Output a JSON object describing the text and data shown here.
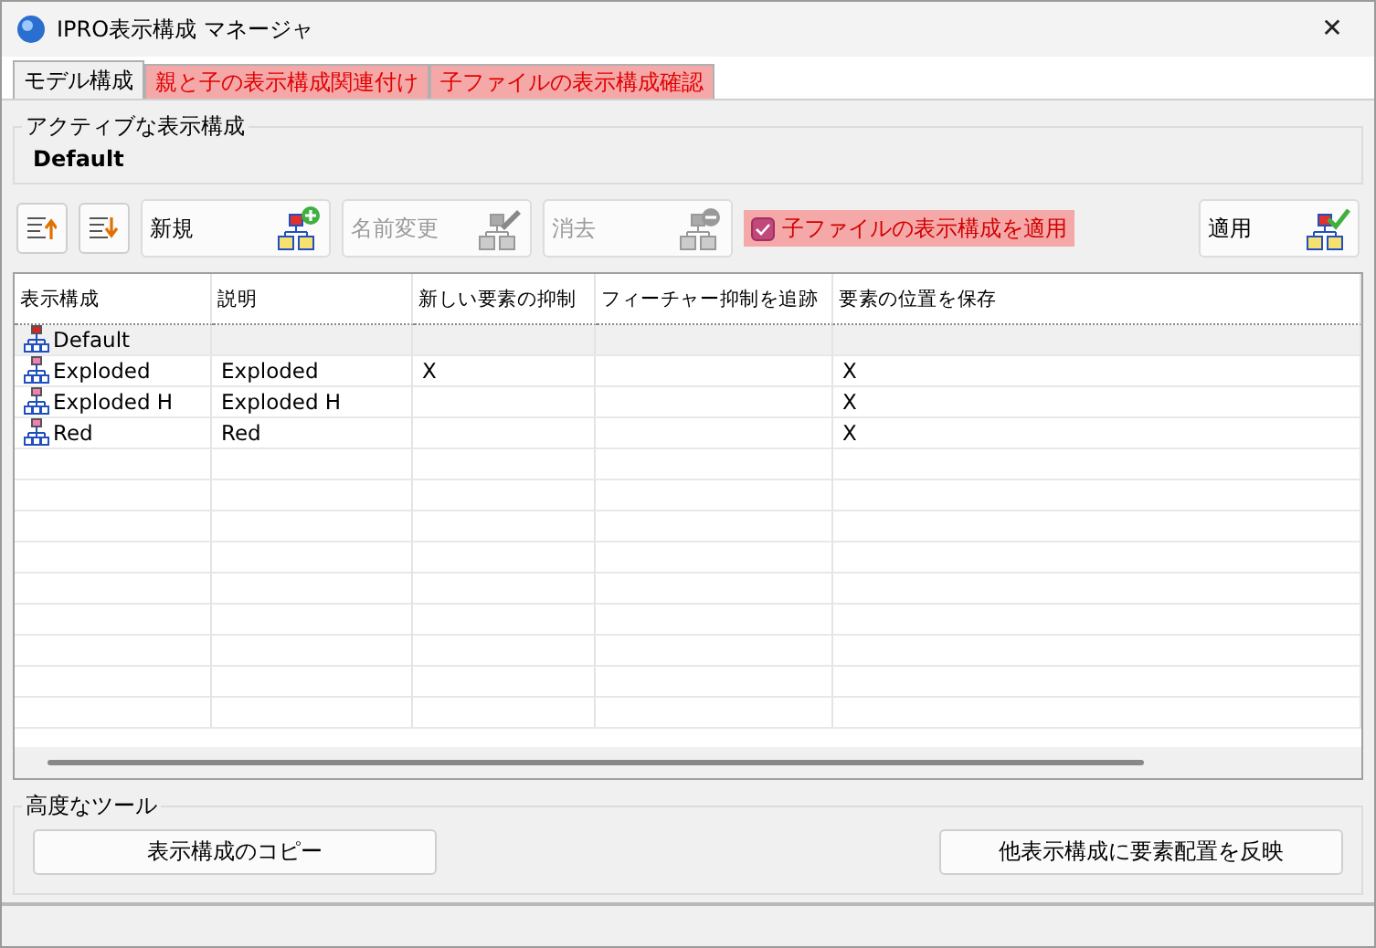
{
  "window": {
    "title": "IPRO表示構成 マネージャ",
    "close": "✕"
  },
  "tabs": [
    {
      "label": "モデル構成",
      "selected": true,
      "alert": false
    },
    {
      "label": "親と子の表示構成関連付け",
      "selected": false,
      "alert": true
    },
    {
      "label": "子ファイルの表示構成確認",
      "selected": false,
      "alert": true
    }
  ],
  "active_group": {
    "title": "アクティブな表示構成",
    "value": "Default"
  },
  "toolbar": {
    "buttons": [
      {
        "kind": "icon"
      },
      {
        "kind": "icon"
      },
      {
        "kind": "text",
        "label": "新規",
        "disabled": false
      },
      {
        "kind": "text",
        "label": "名前変更",
        "disabled": true
      },
      {
        "kind": "text",
        "label": "消去",
        "disabled": true
      }
    ],
    "apply_children": {
      "label": "子ファイルの表示構成を適用",
      "checked": true
    },
    "apply": {
      "label": "適用"
    }
  },
  "table": {
    "columns": [
      "表示構成",
      "説明",
      "新しい要素の抑制",
      "フィーチャー抑制を追跡",
      "要素の位置を保存"
    ],
    "rows": [
      {
        "cells": [
          "Default",
          "",
          "",
          "",
          ""
        ],
        "selected": true
      },
      {
        "cells": [
          "Exploded",
          "Exploded",
          "X",
          "",
          "X"
        ],
        "selected": false
      },
      {
        "cells": [
          "Exploded H",
          "Exploded H",
          "",
          "",
          "X"
        ],
        "selected": false
      },
      {
        "cells": [
          "Red",
          "Red",
          "",
          "",
          "X"
        ],
        "selected": false
      }
    ]
  },
  "tools": {
    "title": "高度なツール",
    "buttons": [
      "表示構成のコピー",
      "他表示構成に要素配置を反映"
    ]
  }
}
